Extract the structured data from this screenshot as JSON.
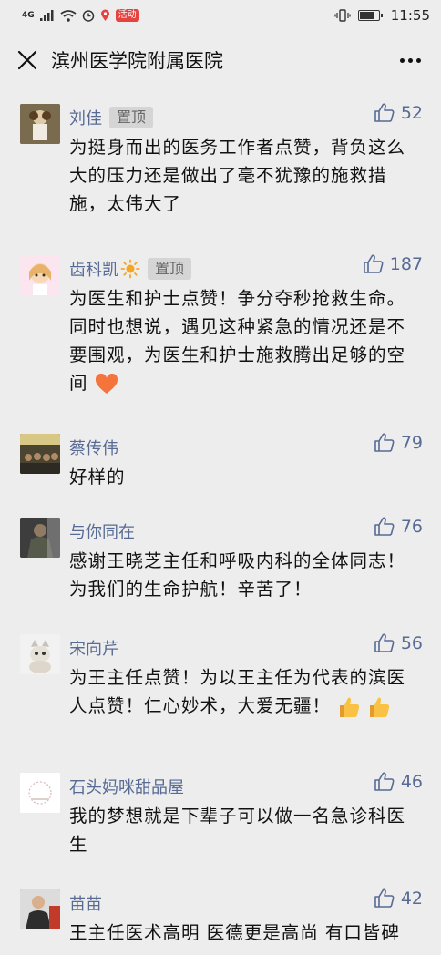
{
  "status": {
    "network": "4G",
    "time": "11:55",
    "badge": "活动"
  },
  "nav": {
    "title": "滨州医学院附属医院"
  },
  "comments": [
    {
      "name": "刘佳",
      "pin": "置顶",
      "likes": "52",
      "text": "为挺身而出的医务工作者点赞，背负这么大的压力还是做出了毫不犹豫的施救措施，太伟大了"
    },
    {
      "name": "齿科凯",
      "pin": "置顶",
      "likes": "187",
      "text": "为医生和护士点赞！争分夺秒抢救生命。同时也想说，遇见这种紧急的情况还是不要围观，为医生和护士施救腾出足够的空间"
    },
    {
      "name": "蔡传伟",
      "likes": "79",
      "text": "好样的"
    },
    {
      "name": "与你同在",
      "likes": "76",
      "text": "感谢王晓芝主任和呼吸内科的全体同志！为我们的生命护航！辛苦了！"
    },
    {
      "name": "宋向芹",
      "likes": "56",
      "text": "为王主任点赞！为以王主任为代表的滨医人点赞！仁心妙术，大爱无疆！"
    },
    {
      "name": "石头妈咪甜品屋",
      "likes": "46",
      "text": "我的梦想就是下辈子可以做一名急诊科医生"
    },
    {
      "name": "苗苗",
      "likes": "42",
      "text": "王主任医术高明 医德更是高尚 有口皆碑"
    }
  ],
  "colors": {
    "name": "#576b95",
    "background": "#ededed",
    "pin_bg": "#d5d5d5"
  },
  "icons": [
    "close-icon",
    "more-icon",
    "thumbs-up-icon",
    "sun-icon",
    "heart-emoji",
    "thumbs-up-emoji"
  ]
}
